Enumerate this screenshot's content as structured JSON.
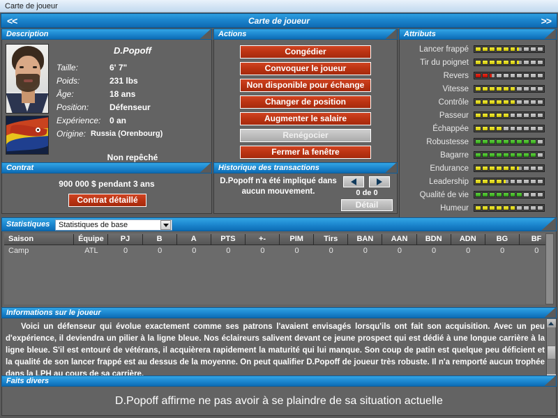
{
  "window": {
    "title": "Carte de joueur"
  },
  "navbar": {
    "prev": "<<",
    "title": "Carte de joueur",
    "next": ">>"
  },
  "description": {
    "header": "Description",
    "player_name": "D.Popoff",
    "fields": [
      {
        "key": "Taille:",
        "value": "6' 7\""
      },
      {
        "key": "Poids:",
        "value": "231 lbs"
      },
      {
        "key": "Âge:",
        "value": "18 ans"
      },
      {
        "key": "Position:",
        "value": "Défenseur"
      },
      {
        "key": "Expérience:",
        "value": "0 an"
      }
    ],
    "origin_key": "Origine:",
    "origin_value": "Russia (Orenbourg)",
    "draft_status": "Non repêché"
  },
  "actions": {
    "header": "Actions",
    "buttons": [
      {
        "label": "Congédier",
        "style": "red"
      },
      {
        "label": "Convoquer le joueur",
        "style": "red"
      },
      {
        "label": "Non disponible pour échange",
        "style": "red"
      },
      {
        "label": "Changer de position",
        "style": "red"
      },
      {
        "label": "Augmenter le salaire",
        "style": "red"
      },
      {
        "label": "Renégocier",
        "style": "gray"
      },
      {
        "label": "Fermer la fenêtre",
        "style": "red"
      }
    ]
  },
  "attributs": {
    "header": "Attributs",
    "max_segments": 10,
    "rows": [
      {
        "label": "Lancer frappé",
        "filled": 6,
        "half": true,
        "color": "yellow"
      },
      {
        "label": "Tir du poignet",
        "filled": 6,
        "half": true,
        "color": "yellow"
      },
      {
        "label": "Revers",
        "filled": 2,
        "half": true,
        "color": "red"
      },
      {
        "label": "Vitesse",
        "filled": 6,
        "half": false,
        "color": "yellow"
      },
      {
        "label": "Contrôle",
        "filled": 6,
        "half": false,
        "color": "yellow"
      },
      {
        "label": "Passeur",
        "filled": 5,
        "half": false,
        "color": "yellow"
      },
      {
        "label": "Échappée",
        "filled": 4,
        "half": false,
        "color": "yellow"
      },
      {
        "label": "Robustesse",
        "filled": 9,
        "half": false,
        "color": "green"
      },
      {
        "label": "Bagarre",
        "filled": 9,
        "half": false,
        "color": "green"
      },
      {
        "label": "Endurance",
        "filled": 6,
        "half": true,
        "color": "yellow"
      },
      {
        "label": "Leadership",
        "filled": 4,
        "half": true,
        "color": "yellow"
      },
      {
        "label": "Qualité de vie",
        "filled": 7,
        "half": false,
        "color": "green"
      },
      {
        "label": "Humeur",
        "filled": 6,
        "half": false,
        "color": "yellow"
      }
    ]
  },
  "contrat": {
    "header": "Contrat",
    "amount": "900 000 $ pendant 3 ans",
    "detail_button": "Contrat détaillé"
  },
  "historique": {
    "header": "Historique des transactions",
    "message": "D.Popoff n'a été impliqué dans aucun mouvement.",
    "counter": "0 de 0",
    "detail_button": "Détail"
  },
  "statistiques": {
    "header": "Statistiques",
    "selected_view": "Statistiques de base",
    "columns": [
      "Saison",
      "Équipe",
      "PJ",
      "B",
      "A",
      "PTS",
      "+-",
      "PIM",
      "Tirs",
      "BAN",
      "AAN",
      "BDN",
      "ADN",
      "BG",
      "BF"
    ],
    "rows": [
      [
        "Camp",
        "ATL",
        "0",
        "0",
        "0",
        "0",
        "0",
        "0",
        "0",
        "0",
        "0",
        "0",
        "0",
        "0",
        "0"
      ]
    ]
  },
  "informations": {
    "header": "Informations sur le joueur",
    "text": "Voici un défenseur qui évolue exactement comme ses patrons l'avaient envisagés lorsqu'ils ont fait son acquisition. Avec un peu d'expérience, il deviendra un pilier à la ligne bleue. Nos éclaireurs salivent devant ce jeune prospect qui est dédié à une longue carrière à la ligne bleue. S'il est entouré de vétérans, il acquièrera rapidement la maturité qui lui manque. Son coup de patin est quelque peu déficient et la qualité de son lancer frappé est au dessus de la moyenne. On peut qualifier D.Popoff de joueur très robuste. Il n'a remporté aucun trophée dans la LPH au cours de sa carrière."
  },
  "faits_divers": {
    "header": "Faits divers",
    "text": "D.Popoff affirme ne pas avoir à se plaindre de sa situation actuelle"
  }
}
